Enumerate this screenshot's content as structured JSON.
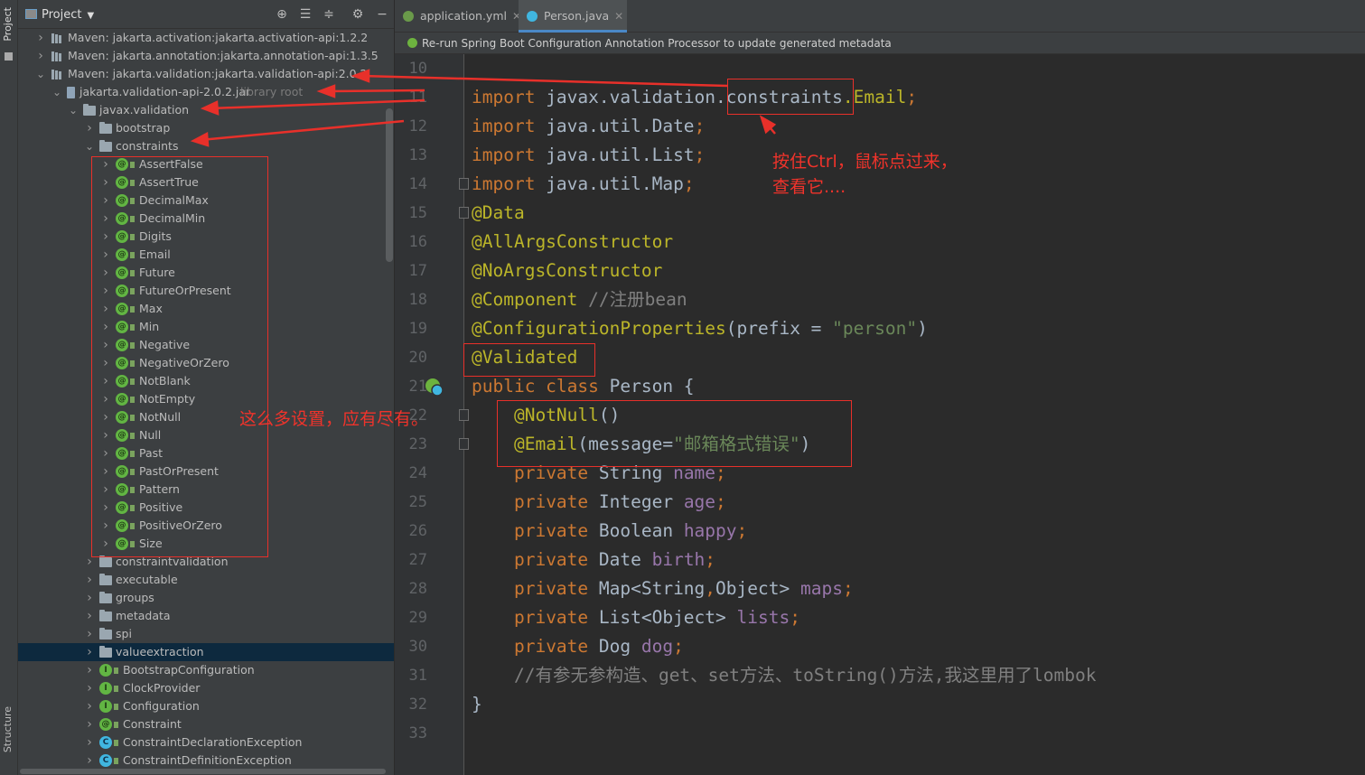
{
  "toolwindow_strip": {
    "project_label": "Project",
    "structure_label": "Structure"
  },
  "project_panel": {
    "title": "Project",
    "header_icons": [
      "locate-icon",
      "expand-all-icon",
      "collapse-all-icon",
      "gear-icon",
      "hide-icon"
    ],
    "tree": [
      {
        "depth": 0,
        "expanded": false,
        "icon": "library",
        "label": "Maven: jakarta.activation:jakarta.activation-api:1.2.2"
      },
      {
        "depth": 0,
        "expanded": false,
        "icon": "library",
        "label": "Maven: jakarta.annotation:jakarta.annotation-api:1.3.5"
      },
      {
        "depth": 0,
        "expanded": true,
        "icon": "library",
        "label": "Maven: jakarta.validation:jakarta.validation-api:2.0.2"
      },
      {
        "depth": 1,
        "expanded": true,
        "icon": "jar",
        "label": "jakarta.validation-api-2.0.2.jar",
        "suffix": "library root"
      },
      {
        "depth": 2,
        "expanded": true,
        "icon": "package",
        "label": "javax.validation"
      },
      {
        "depth": 3,
        "expanded": false,
        "icon": "package",
        "label": "bootstrap"
      },
      {
        "depth": 3,
        "expanded": true,
        "icon": "package",
        "label": "constraints"
      },
      {
        "depth": 4,
        "expanded": false,
        "icon": "annotation",
        "label": "AssertFalse"
      },
      {
        "depth": 4,
        "expanded": false,
        "icon": "annotation",
        "label": "AssertTrue"
      },
      {
        "depth": 4,
        "expanded": false,
        "icon": "annotation",
        "label": "DecimalMax"
      },
      {
        "depth": 4,
        "expanded": false,
        "icon": "annotation",
        "label": "DecimalMin"
      },
      {
        "depth": 4,
        "expanded": false,
        "icon": "annotation",
        "label": "Digits"
      },
      {
        "depth": 4,
        "expanded": false,
        "icon": "annotation",
        "label": "Email"
      },
      {
        "depth": 4,
        "expanded": false,
        "icon": "annotation",
        "label": "Future"
      },
      {
        "depth": 4,
        "expanded": false,
        "icon": "annotation",
        "label": "FutureOrPresent"
      },
      {
        "depth": 4,
        "expanded": false,
        "icon": "annotation",
        "label": "Max"
      },
      {
        "depth": 4,
        "expanded": false,
        "icon": "annotation",
        "label": "Min"
      },
      {
        "depth": 4,
        "expanded": false,
        "icon": "annotation",
        "label": "Negative"
      },
      {
        "depth": 4,
        "expanded": false,
        "icon": "annotation",
        "label": "NegativeOrZero"
      },
      {
        "depth": 4,
        "expanded": false,
        "icon": "annotation",
        "label": "NotBlank"
      },
      {
        "depth": 4,
        "expanded": false,
        "icon": "annotation",
        "label": "NotEmpty"
      },
      {
        "depth": 4,
        "expanded": false,
        "icon": "annotation",
        "label": "NotNull"
      },
      {
        "depth": 4,
        "expanded": false,
        "icon": "annotation",
        "label": "Null"
      },
      {
        "depth": 4,
        "expanded": false,
        "icon": "annotation",
        "label": "Past"
      },
      {
        "depth": 4,
        "expanded": false,
        "icon": "annotation",
        "label": "PastOrPresent"
      },
      {
        "depth": 4,
        "expanded": false,
        "icon": "annotation",
        "label": "Pattern"
      },
      {
        "depth": 4,
        "expanded": false,
        "icon": "annotation",
        "label": "Positive"
      },
      {
        "depth": 4,
        "expanded": false,
        "icon": "annotation",
        "label": "PositiveOrZero"
      },
      {
        "depth": 4,
        "expanded": false,
        "icon": "annotation",
        "label": "Size"
      },
      {
        "depth": 3,
        "expanded": false,
        "icon": "package",
        "label": "constraintvalidation"
      },
      {
        "depth": 3,
        "expanded": false,
        "icon": "package",
        "label": "executable"
      },
      {
        "depth": 3,
        "expanded": false,
        "icon": "package",
        "label": "groups"
      },
      {
        "depth": 3,
        "expanded": false,
        "icon": "package",
        "label": "metadata"
      },
      {
        "depth": 3,
        "expanded": false,
        "icon": "package",
        "label": "spi"
      },
      {
        "depth": 3,
        "expanded": false,
        "icon": "package",
        "label": "valueextraction",
        "selected": true
      },
      {
        "depth": 3,
        "expanded": false,
        "icon": "interface",
        "label": "BootstrapConfiguration"
      },
      {
        "depth": 3,
        "expanded": false,
        "icon": "interface",
        "label": "ClockProvider"
      },
      {
        "depth": 3,
        "expanded": false,
        "icon": "interface",
        "label": "Configuration"
      },
      {
        "depth": 3,
        "expanded": false,
        "icon": "annotation",
        "label": "Constraint"
      },
      {
        "depth": 3,
        "expanded": false,
        "icon": "class",
        "label": "ConstraintDeclarationException"
      },
      {
        "depth": 3,
        "expanded": false,
        "icon": "class",
        "label": "ConstraintDefinitionException"
      }
    ]
  },
  "editor_tabs": [
    {
      "label": "application.yml",
      "icon": "yaml-icon",
      "active": false,
      "icon_color": "#6a9a4a"
    },
    {
      "label": "Person.java",
      "icon": "class-icon",
      "active": true,
      "icon_color": "#40b6e0"
    }
  ],
  "notification": {
    "text": "Re-run Spring Boot Configuration Annotation Processor to update generated metadata",
    "icon": "spring-icon"
  },
  "editor": {
    "lines": [
      {
        "n": "10",
        "tokens": []
      },
      {
        "n": "11",
        "tokens": [
          {
            "t": "kw",
            "s": "import "
          },
          {
            "t": "pl",
            "s": "javax.validation."
          },
          {
            "t": "pl",
            "s": "constraints"
          },
          {
            "t": "an",
            "s": ".Email"
          },
          {
            "t": "kw",
            "s": ";"
          }
        ]
      },
      {
        "n": "12",
        "tokens": [
          {
            "t": "kw",
            "s": "import "
          },
          {
            "t": "pl",
            "s": "java.util.Date"
          },
          {
            "t": "kw",
            "s": ";"
          }
        ]
      },
      {
        "n": "13",
        "tokens": [
          {
            "t": "kw",
            "s": "import "
          },
          {
            "t": "pl",
            "s": "java.util.List"
          },
          {
            "t": "kw",
            "s": ";"
          }
        ]
      },
      {
        "n": "14",
        "tokens": [
          {
            "t": "kw",
            "s": "import "
          },
          {
            "t": "pl",
            "s": "java.util.Map"
          },
          {
            "t": "kw",
            "s": ";"
          }
        ]
      },
      {
        "n": "15",
        "tokens": [
          {
            "t": "an",
            "s": "@Data"
          }
        ]
      },
      {
        "n": "16",
        "tokens": [
          {
            "t": "an",
            "s": "@AllArgsConstructor"
          }
        ]
      },
      {
        "n": "17",
        "tokens": [
          {
            "t": "an",
            "s": "@NoArgsConstructor"
          }
        ]
      },
      {
        "n": "18",
        "tokens": [
          {
            "t": "an",
            "s": "@Component "
          },
          {
            "t": "cm",
            "s": "//注册bean"
          }
        ]
      },
      {
        "n": "19",
        "tokens": [
          {
            "t": "an",
            "s": "@ConfigurationProperties"
          },
          {
            "t": "pl",
            "s": "(prefix = "
          },
          {
            "t": "str",
            "s": "\"person\""
          },
          {
            "t": "pl",
            "s": ")"
          }
        ]
      },
      {
        "n": "20",
        "tokens": [
          {
            "t": "an",
            "s": "@Validated"
          }
        ]
      },
      {
        "n": "21",
        "tokens": [
          {
            "t": "kw",
            "s": "public class "
          },
          {
            "t": "pl",
            "s": "Person {"
          }
        ]
      },
      {
        "n": "22",
        "tokens": [
          {
            "t": "pl",
            "s": "    "
          },
          {
            "t": "an",
            "s": "@NotNull"
          },
          {
            "t": "pl",
            "s": "()"
          }
        ]
      },
      {
        "n": "23",
        "tokens": [
          {
            "t": "pl",
            "s": "    "
          },
          {
            "t": "an",
            "s": "@Email"
          },
          {
            "t": "pl",
            "s": "(message="
          },
          {
            "t": "str",
            "s": "\"邮箱格式错误\""
          },
          {
            "t": "pl",
            "s": ")"
          }
        ]
      },
      {
        "n": "24",
        "tokens": [
          {
            "t": "pl",
            "s": "    "
          },
          {
            "t": "kw",
            "s": "private "
          },
          {
            "t": "pl",
            "s": "String "
          },
          {
            "t": "fld",
            "s": "name"
          },
          {
            "t": "kw",
            "s": ";"
          }
        ]
      },
      {
        "n": "25",
        "tokens": [
          {
            "t": "pl",
            "s": "    "
          },
          {
            "t": "kw",
            "s": "private "
          },
          {
            "t": "pl",
            "s": "Integer "
          },
          {
            "t": "fld",
            "s": "age"
          },
          {
            "t": "kw",
            "s": ";"
          }
        ]
      },
      {
        "n": "26",
        "tokens": [
          {
            "t": "pl",
            "s": "    "
          },
          {
            "t": "kw",
            "s": "private "
          },
          {
            "t": "pl",
            "s": "Boolean "
          },
          {
            "t": "fld",
            "s": "happy"
          },
          {
            "t": "kw",
            "s": ";"
          }
        ]
      },
      {
        "n": "27",
        "tokens": [
          {
            "t": "pl",
            "s": "    "
          },
          {
            "t": "kw",
            "s": "private "
          },
          {
            "t": "pl",
            "s": "Date "
          },
          {
            "t": "fld",
            "s": "birth"
          },
          {
            "t": "kw",
            "s": ";"
          }
        ]
      },
      {
        "n": "28",
        "tokens": [
          {
            "t": "pl",
            "s": "    "
          },
          {
            "t": "kw",
            "s": "private "
          },
          {
            "t": "pl",
            "s": "Map<String"
          },
          {
            "t": "kw",
            "s": ","
          },
          {
            "t": "pl",
            "s": "Object> "
          },
          {
            "t": "fld",
            "s": "maps"
          },
          {
            "t": "kw",
            "s": ";"
          }
        ]
      },
      {
        "n": "29",
        "tokens": [
          {
            "t": "pl",
            "s": "    "
          },
          {
            "t": "kw",
            "s": "private "
          },
          {
            "t": "pl",
            "s": "List<Object> "
          },
          {
            "t": "fld",
            "s": "lists"
          },
          {
            "t": "kw",
            "s": ";"
          }
        ]
      },
      {
        "n": "30",
        "tokens": [
          {
            "t": "pl",
            "s": "    "
          },
          {
            "t": "kw",
            "s": "private "
          },
          {
            "t": "pl",
            "s": "Dog "
          },
          {
            "t": "fld",
            "s": "dog"
          },
          {
            "t": "kw",
            "s": ";"
          }
        ]
      },
      {
        "n": "31",
        "tokens": [
          {
            "t": "pl",
            "s": "    "
          },
          {
            "t": "cm",
            "s": "//有参无参构造、get、set方法、toString()方法,我这里用了lombok"
          }
        ]
      },
      {
        "n": "32",
        "tokens": [
          {
            "t": "pl",
            "s": "}"
          }
        ]
      },
      {
        "n": "33",
        "tokens": []
      }
    ]
  },
  "annotations": {
    "ctrl_hint_line1": "按住Ctrl，鼠标点过来，",
    "ctrl_hint_line2": "查看它....",
    "settings_note": "这么多设置，应有尽有。",
    "color": "#e8302a"
  },
  "colors": {
    "keyword": "#cc7832",
    "annotation": "#bbb529",
    "string": "#6a8759",
    "comment": "#808080",
    "field": "#9876aa",
    "plain": "#a9b7c6",
    "selection": "#0d293e"
  }
}
